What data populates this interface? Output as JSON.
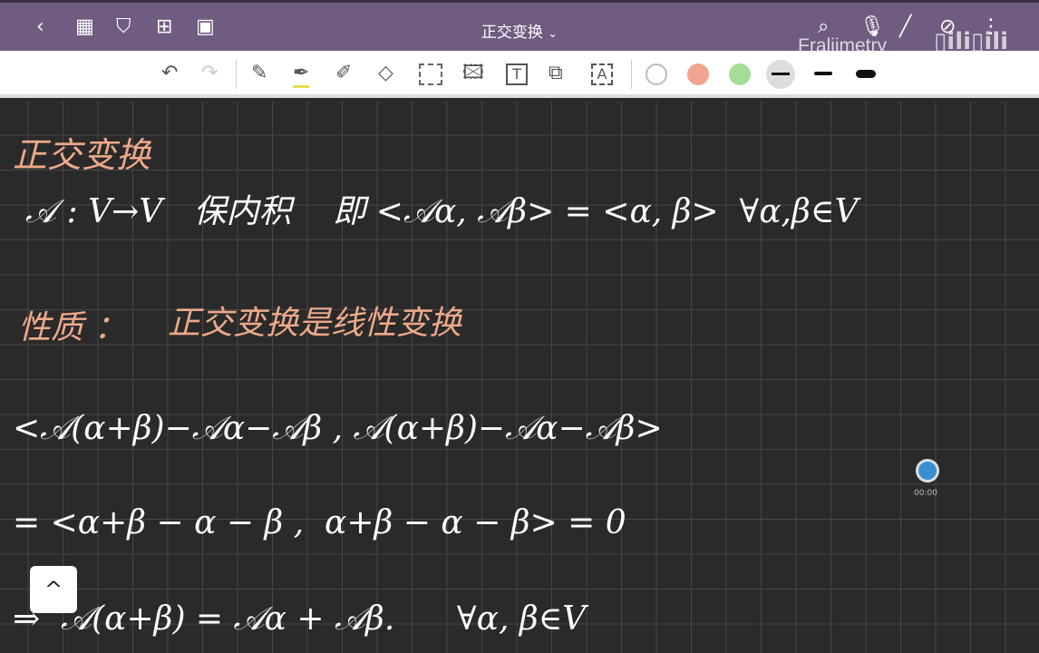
{
  "header": {
    "title": "正交变换",
    "title_chevron": "⌄",
    "back": "‹",
    "watermark": "Fraliimetry",
    "watermark_logo": "bilibili"
  },
  "toolbar": {
    "colors": {
      "white": "#ffffff",
      "salmon": "#f2a58e",
      "green": "#a6dc98",
      "black": "#111111"
    }
  },
  "note": {
    "heading": "正交变换",
    "line1": "𝒜 : V→V   保内积    即 <𝒜α, 𝒜β> = <α, β>  ∀α,β∈V",
    "property_label": "性质 ：",
    "property_text": "正交变换是线性变换",
    "line2": "<𝒜(α+β)−𝒜α−𝒜β , 𝒜(α+β)−𝒜α−𝒜β>",
    "line3": "= <α+β − α − β ,  α+β − α − β> = 0",
    "line4": "⇒  𝒜(α+β) = 𝒜α + 𝒜β.      ∀α, β∈V"
  },
  "recording": {
    "time": "00:00"
  },
  "scroll_up": "^"
}
